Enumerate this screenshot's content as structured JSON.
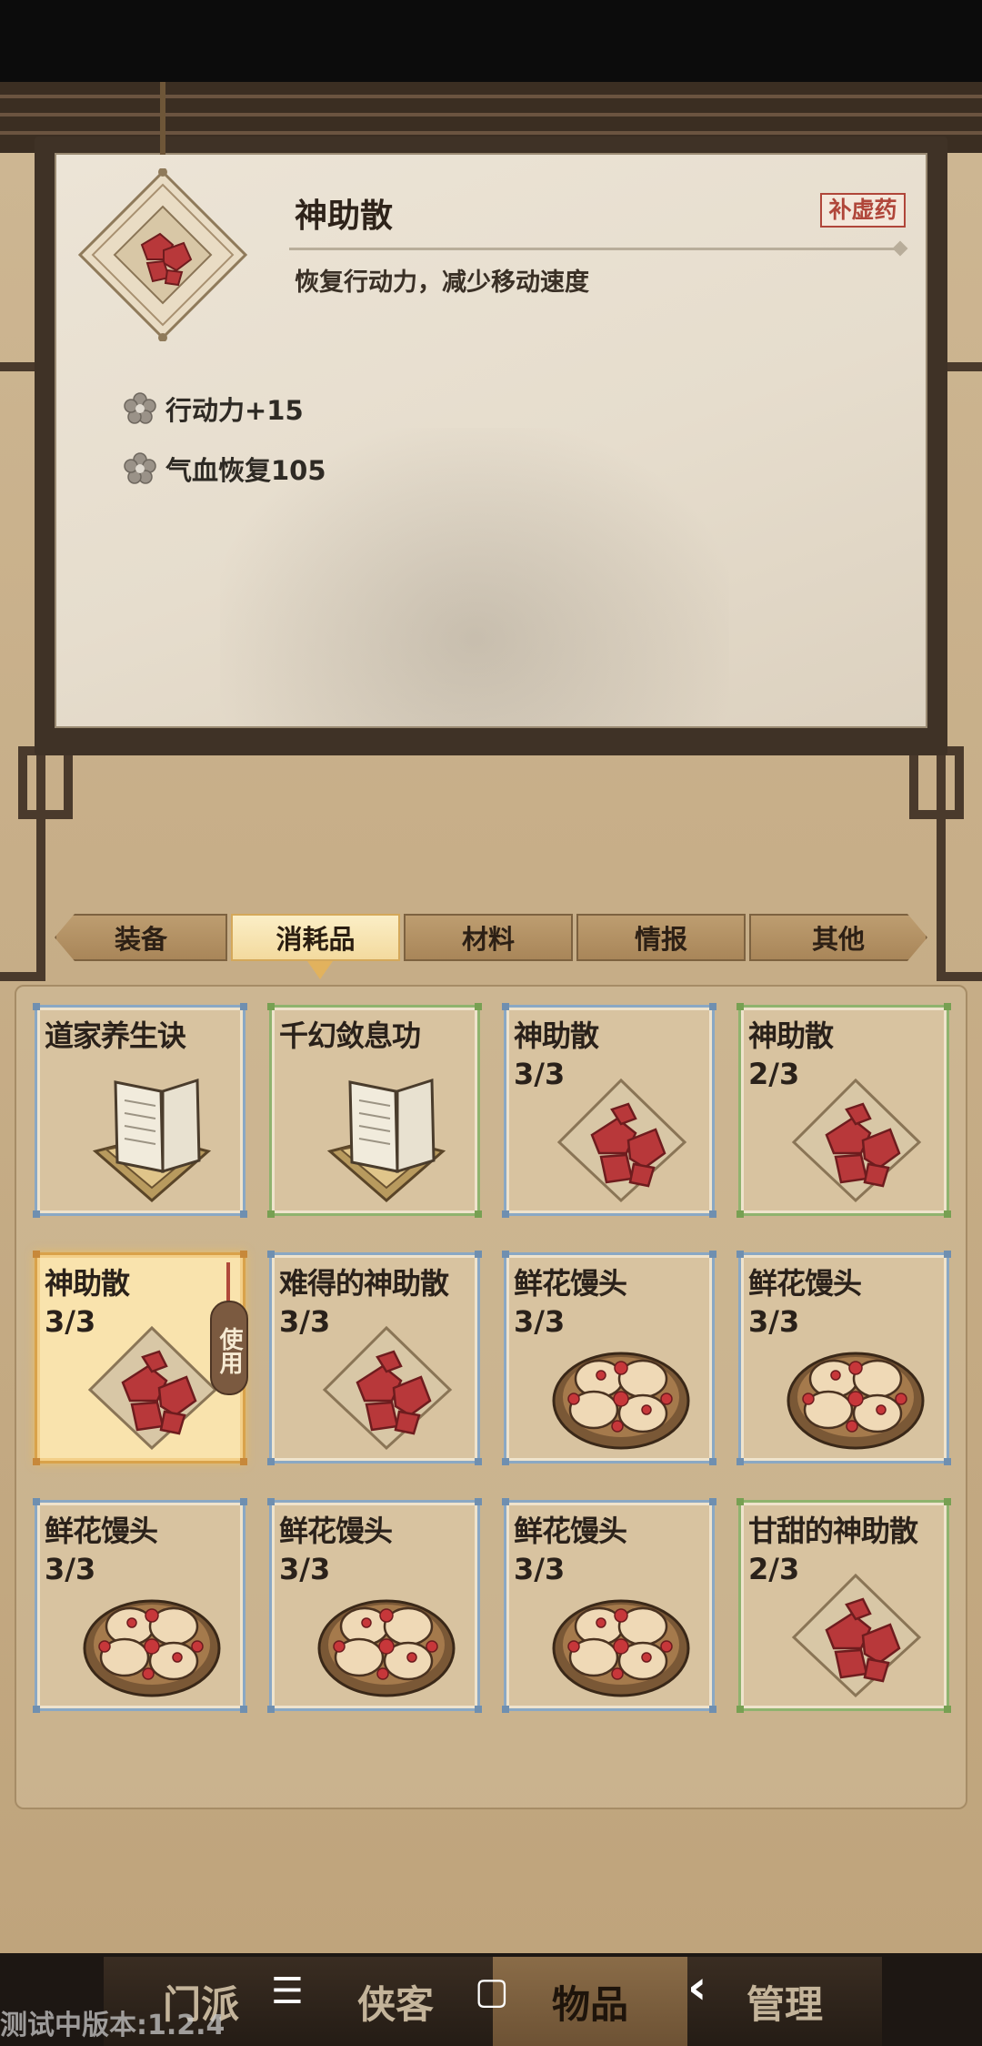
{
  "detail": {
    "name": "神助散",
    "tag": "补虚药",
    "description": "恢复行动力，减少移动速度",
    "effects": [
      "行动力+15",
      "气血恢复105"
    ]
  },
  "tabs": [
    {
      "label": "装备",
      "active": false
    },
    {
      "label": "消耗品",
      "active": true
    },
    {
      "label": "材料",
      "active": false
    },
    {
      "label": "情报",
      "active": false
    },
    {
      "label": "其他",
      "active": false
    }
  ],
  "inventory": [
    {
      "name": "道家养生诀",
      "count": "",
      "icon": "book-icon",
      "frame": "blue"
    },
    {
      "name": "千幻敛息功",
      "count": "",
      "icon": "book-icon",
      "frame": "green"
    },
    {
      "name": "神助散",
      "count": "3/3",
      "icon": "red-powder-icon",
      "frame": "blue"
    },
    {
      "name": "神助散",
      "count": "2/3",
      "icon": "red-powder-icon",
      "frame": "green"
    },
    {
      "name": "神助散",
      "count": "3/3",
      "icon": "red-powder-icon",
      "frame": "selected"
    },
    {
      "name": "难得的神助散",
      "count": "3/3",
      "icon": "red-powder-icon",
      "frame": "blue"
    },
    {
      "name": "鲜花馒头",
      "count": "3/3",
      "icon": "steamed-bun-icon",
      "frame": "blue"
    },
    {
      "name": "鲜花馒头",
      "count": "3/3",
      "icon": "steamed-bun-icon",
      "frame": "blue"
    },
    {
      "name": "鲜花馒头",
      "count": "3/3",
      "icon": "steamed-bun-icon",
      "frame": "blue"
    },
    {
      "name": "鲜花馒头",
      "count": "3/3",
      "icon": "steamed-bun-icon",
      "frame": "blue"
    },
    {
      "name": "鲜花馒头",
      "count": "3/3",
      "icon": "steamed-bun-icon",
      "frame": "blue"
    },
    {
      "name": "甘甜的神助散",
      "count": "2/3",
      "icon": "red-powder-icon",
      "frame": "green"
    }
  ],
  "use_button": "使用",
  "bottom_nav": [
    {
      "label": "门派",
      "active": false
    },
    {
      "label": "侠客",
      "active": false
    },
    {
      "label": "物品",
      "active": true
    },
    {
      "label": "管理",
      "active": false
    }
  ],
  "system_nav": {
    "menu": "☰",
    "home": "▢",
    "back": "‹"
  },
  "version": "测试中版本:1.2.4",
  "colors": {
    "selected_frame": "#d9a24a",
    "blue_frame": "#8aa8c4",
    "green_frame": "#8fb36e",
    "tag_red": "#b0463a"
  }
}
